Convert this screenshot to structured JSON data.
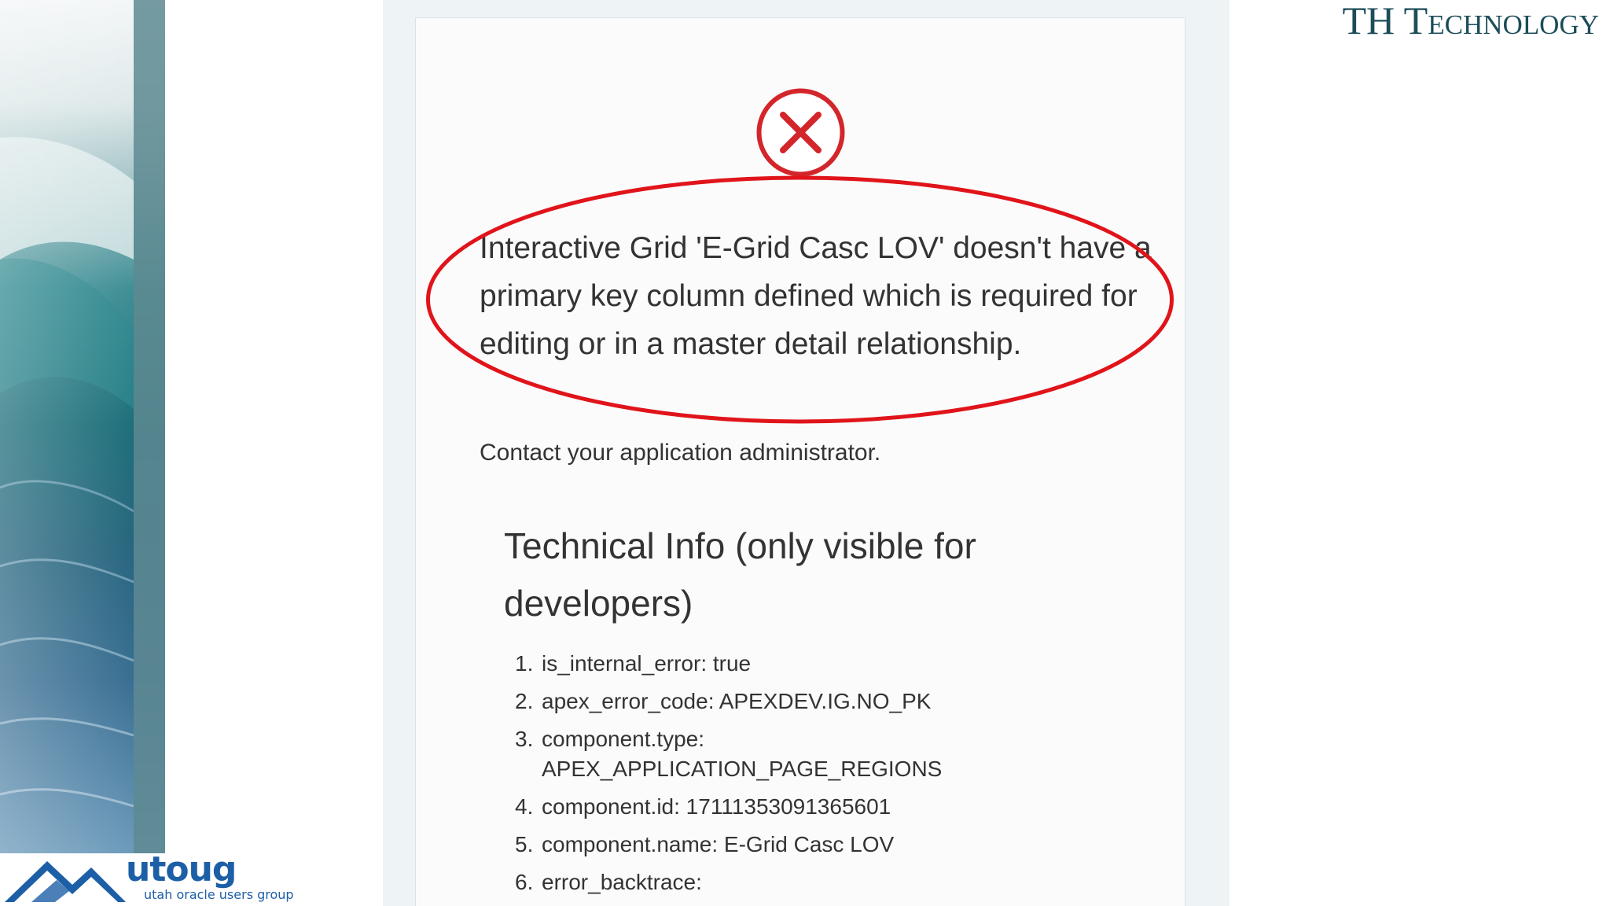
{
  "brand": {
    "name": "TH Technology"
  },
  "logo": {
    "word": "utoug",
    "tagline": "utah oracle users group"
  },
  "error": {
    "message": "Interactive Grid 'E-Grid Casc LOV' doesn't have a primary key column defined which is required for editing or in a master detail relationship.",
    "contact": "Contact your application administrator.",
    "tech_heading": "Technical Info (only visible for developers)",
    "tech_items": [
      {
        "num": "1.",
        "text": "is_internal_error: true"
      },
      {
        "num": "2.",
        "text": "apex_error_code: APEXDEV.IG.NO_PK"
      },
      {
        "num": "3.",
        "text": "component.type: APEX_APPLICATION_PAGE_REGIONS"
      },
      {
        "num": "4.",
        "text": "component.id: 17111353091365601"
      },
      {
        "num": "5.",
        "text": "component.name: E-Grid Casc LOV"
      },
      {
        "num": "6.",
        "text": "error_backtrace:"
      }
    ]
  },
  "colors": {
    "error_red": "#d3262b",
    "highlight_red": "#e0141a",
    "brand_teal": "#1c4d5a",
    "logo_blue": "#1d5fa6"
  },
  "icons": {
    "error": "error-x-circle-icon"
  }
}
